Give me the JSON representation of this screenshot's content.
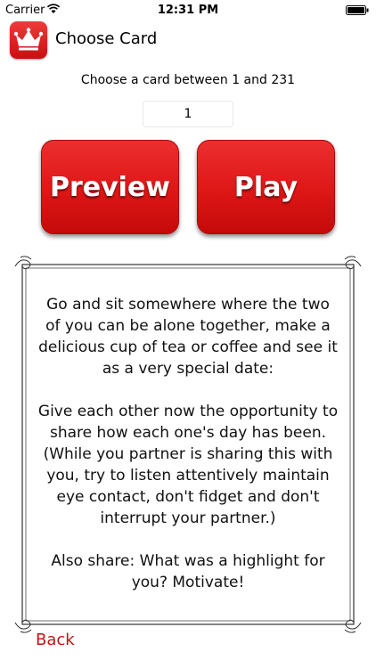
{
  "status_bar": {
    "carrier": "Carrier",
    "time": "12:31 PM"
  },
  "nav": {
    "title": "Choose Card",
    "icon": "crown-icon"
  },
  "chooser": {
    "prompt": "Choose a card between 1 and 231",
    "value": "1",
    "range_min": 1,
    "range_max": 231
  },
  "buttons": {
    "preview_label": "Preview",
    "play_label": "Play"
  },
  "card": {
    "paragraphs": [
      "Go and sit somewhere where the two of you can be alone together, make a delicious cup of tea or coffee and see it as a very special date:",
      "Give each other now the opportunity to share how each one's day has been. (While you partner is sharing this with you, try to listen attentively maintain eye contact, don't fidget and don't interrupt your partner.)",
      "Also share: What was a highlight for you? Motivate!"
    ]
  },
  "footer": {
    "back_label": "Back"
  },
  "colors": {
    "accent": "#c41313",
    "button_red": "#de1616"
  }
}
